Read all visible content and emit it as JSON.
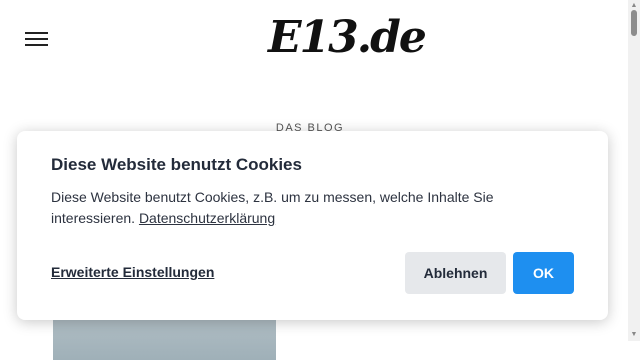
{
  "header": {
    "logo_text": "E13.de",
    "section_label": "DAS BLOG"
  },
  "cookie_dialog": {
    "title": "Diese Website benutzt Cookies",
    "text": "Diese Website benutzt Cookies, z.B. um zu messen, welche Inhalte Sie interessieren.",
    "privacy_link": "Datenschutzerklärung",
    "advanced_settings": "Erweiterte Einstellungen",
    "decline_label": "Ablehnen",
    "accept_label": "OK"
  },
  "colors": {
    "accent": "#1e8ff0",
    "decline_bg": "#e6e8eb"
  },
  "icons": [
    "hamburger-menu-icon",
    "scroll-up-icon",
    "scroll-down-icon"
  ]
}
